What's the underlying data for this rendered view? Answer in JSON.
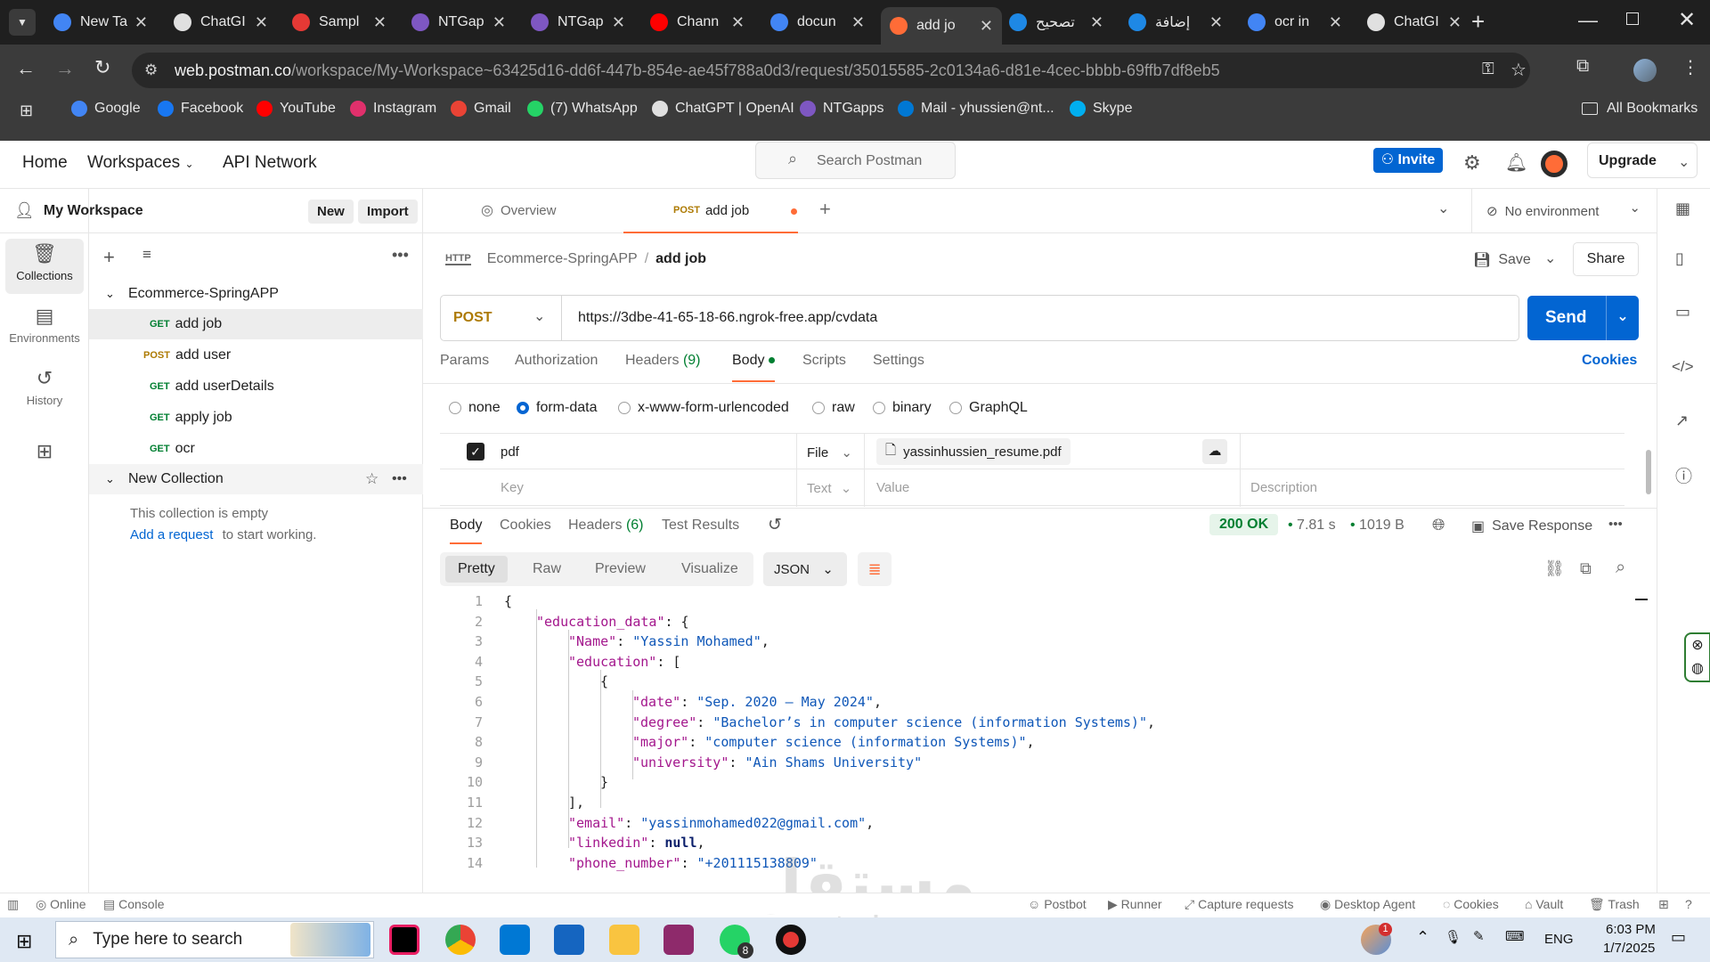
{
  "browser": {
    "tabs": [
      {
        "title": "New Ta",
        "color": "#4285f4"
      },
      {
        "title": "ChatGI",
        "color": "#e0e0e0"
      },
      {
        "title": "Sampl",
        "color": "#e53935"
      },
      {
        "title": "NTGap",
        "color": "#7e57c2"
      },
      {
        "title": "NTGap",
        "color": "#7e57c2"
      },
      {
        "title": "Chann",
        "color": "#ff0000"
      },
      {
        "title": "docun",
        "color": "#4285f4"
      },
      {
        "title": "add jo",
        "color": "#ff6c37"
      },
      {
        "title": "تصحيح",
        "color": "#1e88e5"
      },
      {
        "title": "إضافة",
        "color": "#1e88e5"
      },
      {
        "title": "ocr in",
        "color": "#4285f4"
      },
      {
        "title": "ChatGI",
        "color": "#e0e0e0"
      }
    ],
    "url_host": "web.postman.co",
    "url_path": "/workspace/My-Workspace~63425d16-dd6f-447b-854e-ae45f788a0d3/request/35015585-2c0134a6-d81e-4cec-bbbb-69ffb7df8eb5",
    "bookmarks": [
      {
        "label": "Google",
        "color": "#4285f4"
      },
      {
        "label": "Facebook",
        "color": "#1877f2"
      },
      {
        "label": "YouTube",
        "color": "#ff0000"
      },
      {
        "label": "Instagram",
        "color": "#e1306c"
      },
      {
        "label": "Gmail",
        "color": "#ea4335"
      },
      {
        "label": "(7) WhatsApp",
        "color": "#25d366"
      },
      {
        "label": "ChatGPT | OpenAI",
        "color": "#e0e0e0"
      },
      {
        "label": "NTGapps",
        "color": "#7e57c2"
      },
      {
        "label": "Mail - yhussien@nt...",
        "color": "#0078d4"
      },
      {
        "label": "Skype",
        "color": "#00aff0"
      }
    ],
    "all_bookmarks": "All Bookmarks"
  },
  "header": {
    "home": "Home",
    "workspaces": "Workspaces",
    "api_network": "API Network",
    "search_placeholder": "Search Postman",
    "invite": "Invite",
    "upgrade": "Upgrade"
  },
  "sidebar": {
    "workspace": "My Workspace",
    "new": "New",
    "import": "Import",
    "rail": [
      "Collections",
      "Environments",
      "History"
    ],
    "collection1": "Ecommerce-SpringAPP",
    "requests": [
      {
        "method": "GET",
        "name": "add job"
      },
      {
        "method": "POST",
        "name": "add user"
      },
      {
        "method": "GET",
        "name": "add userDetails"
      },
      {
        "method": "GET",
        "name": "apply job"
      },
      {
        "method": "GET",
        "name": "ocr"
      }
    ],
    "collection2": "New Collection",
    "empty_text": "This collection is empty",
    "add_request": "Add a request",
    "start_working": "to start working."
  },
  "workbench": {
    "overview": "Overview",
    "tab_method": "POST",
    "tab_name": "add job",
    "environment": "No environment",
    "breadcrumb_collection": "Ecommerce-SpringAPP",
    "breadcrumb_request": "add job",
    "save": "Save",
    "share": "Share",
    "method": "POST",
    "url": "https://3dbe-41-65-18-66.ngrok-free.app/cvdata",
    "send": "Send",
    "cookies": "Cookies",
    "req_tabs": [
      "Params",
      "Authorization",
      "Headers",
      "(9)",
      "Body",
      "Scripts",
      "Settings"
    ],
    "body_types": [
      "none",
      "form-data",
      "x-www-form-urlencoded",
      "raw",
      "binary",
      "GraphQL"
    ],
    "form_key": "pdf",
    "form_type": "File",
    "form_file": "yassinhussien_resume.pdf",
    "key_placeholder": "Key",
    "type_placeholder": "Text",
    "value_placeholder": "Value",
    "description_placeholder": "Description"
  },
  "response": {
    "tabs": [
      "Body",
      "Cookies",
      "Headers",
      "(6)",
      "Test Results"
    ],
    "status": "200 OK",
    "time": "7.81 s",
    "size": "1019 B",
    "save_response": "Save Response",
    "views": [
      "Pretty",
      "Raw",
      "Preview",
      "Visualize"
    ],
    "format": "JSON",
    "lines": [
      {
        "n": "1",
        "ind": 0,
        "t": "{"
      },
      {
        "n": "2",
        "ind": 1,
        "k": "\"education_data\"",
        "t": ": {"
      },
      {
        "n": "3",
        "ind": 2,
        "k": "\"Name\"",
        "s": "\"Yassin Mohamed\"",
        "t": ","
      },
      {
        "n": "4",
        "ind": 2,
        "k": "\"education\"",
        "t": ": ["
      },
      {
        "n": "5",
        "ind": 3,
        "t": "{"
      },
      {
        "n": "6",
        "ind": 4,
        "k": "\"date\"",
        "s": "\"Sep. 2020 – May 2024\"",
        "t": ","
      },
      {
        "n": "7",
        "ind": 4,
        "k": "\"degree\"",
        "s": "\"Bachelor’s in computer science (information Systems)\"",
        "t": ","
      },
      {
        "n": "8",
        "ind": 4,
        "k": "\"major\"",
        "s": "\"computer science (information Systems)\"",
        "t": ","
      },
      {
        "n": "9",
        "ind": 4,
        "k": "\"university\"",
        "s": "\"Ain Shams University\"",
        "t": ""
      },
      {
        "n": "10",
        "ind": 3,
        "t": "}"
      },
      {
        "n": "11",
        "ind": 2,
        "t": "],"
      },
      {
        "n": "12",
        "ind": 2,
        "k": "\"email\"",
        "s": "\"yassinmohamed022@gmail.com\"",
        "t": ","
      },
      {
        "n": "13",
        "ind": 2,
        "k": "\"linkedin\"",
        "nv": "null",
        "t": ","
      },
      {
        "n": "14",
        "ind": 2,
        "k": "\"phone_number\"",
        "s": "\"+201115138809\"",
        "t": ""
      }
    ]
  },
  "statusbar": {
    "online": "Online",
    "console": "Console",
    "right": [
      "Postbot",
      "Runner",
      "Capture requests",
      "Desktop Agent",
      "Cookies",
      "Vault",
      "Trash"
    ]
  },
  "taskbar": {
    "search": "Type here to search",
    "lang": "ENG",
    "time": "6:03 PM",
    "date": "1/7/2025",
    "whatsapp_badge": "8",
    "notif_badge": "1"
  },
  "watermark": {
    "arabic": "مستقل",
    "latin": "mostaql.com"
  },
  "colors": {
    "accent": "#0265d2",
    "postman": "#ff6c37",
    "get": "#007f31",
    "post": "#ad7a03"
  }
}
